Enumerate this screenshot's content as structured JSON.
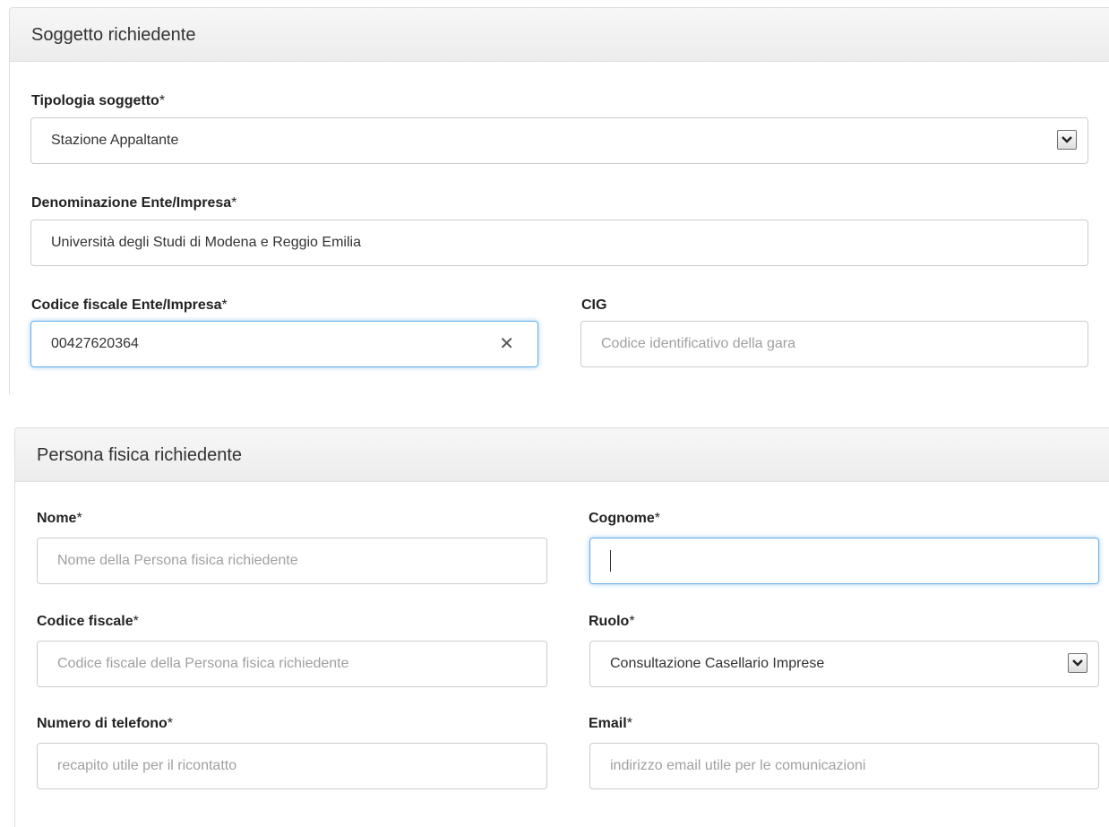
{
  "soggetto": {
    "title": "Soggetto richiedente",
    "tipologia": {
      "label": "Tipologia soggetto",
      "req": "*",
      "value": "Stazione Appaltante"
    },
    "denominazione": {
      "label": "Denominazione Ente/Impresa",
      "req": "*",
      "value": "Università degli Studi di Modena e Reggio Emilia"
    },
    "codice_fiscale": {
      "label": "Codice fiscale Ente/Impresa",
      "req": "*",
      "value": "00427620364",
      "clear": "✕"
    },
    "cig": {
      "label": "CIG",
      "placeholder": "Codice identificativo della gara"
    }
  },
  "persona": {
    "title": "Persona fisica richiedente",
    "nome": {
      "label": "Nome",
      "req": "*",
      "placeholder": "Nome della Persona fisica richiedente"
    },
    "cognome": {
      "label": "Cognome",
      "req": "*",
      "value": ""
    },
    "codice_fiscale": {
      "label": "Codice fiscale",
      "req": "*",
      "placeholder": "Codice fiscale della Persona fisica richiedente"
    },
    "ruolo": {
      "label": "Ruolo",
      "req": "*",
      "value": "Consultazione Casellario Imprese"
    },
    "telefono": {
      "label": "Numero di telefono",
      "req": "*",
      "placeholder": "recapito utile per il ricontatto"
    },
    "email": {
      "label": "Email",
      "req": "*",
      "placeholder": "indirizzo email utile per le comunicazioni"
    }
  },
  "icons": {
    "select_arrow": "chevron-down-icon",
    "clear": "close-icon"
  },
  "colors": {
    "focus_border": "#66afe9",
    "panel_heading": "#f2f2f2",
    "placeholder": "#a0a0a0"
  }
}
